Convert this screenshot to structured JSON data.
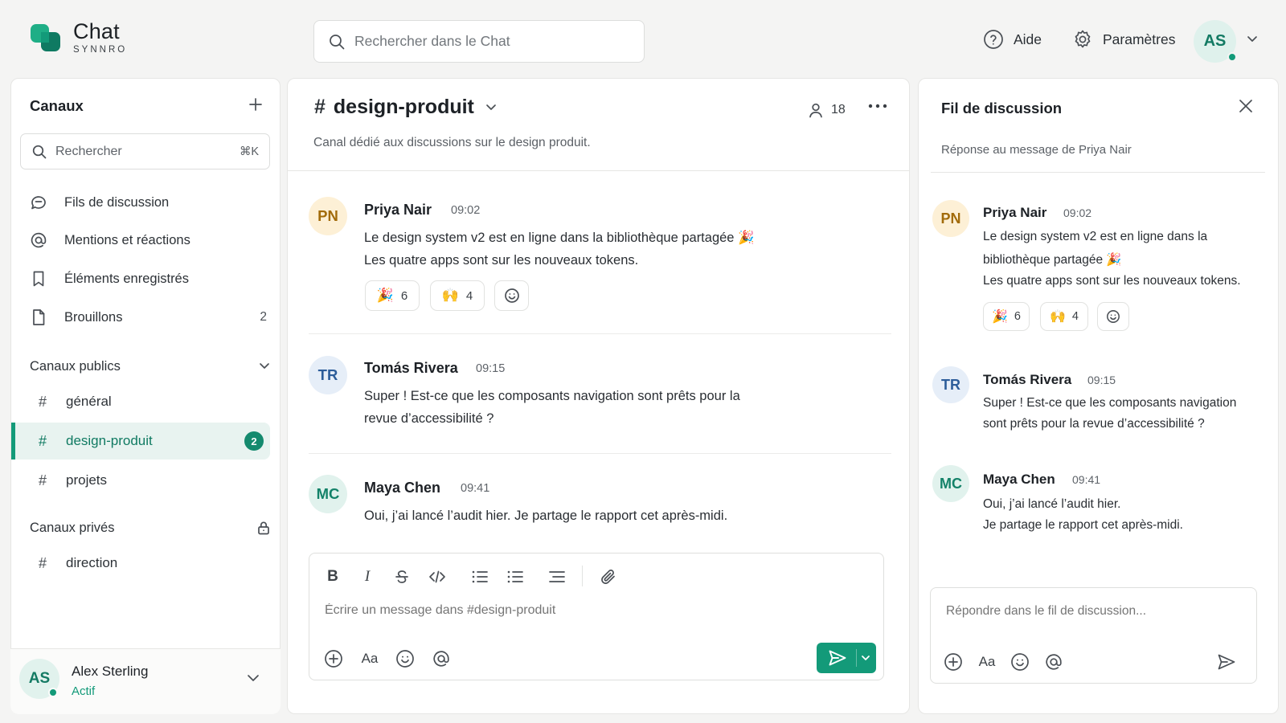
{
  "app": {
    "name": "Chat",
    "brand": "SYNNRO"
  },
  "header": {
    "search_placeholder": "Rechercher dans le Chat",
    "help_label": "Aide",
    "settings_label": "Paramètres",
    "user_initials": "AS"
  },
  "sidebar": {
    "title": "Canaux",
    "search_placeholder": "Rechercher",
    "search_shortcut": "⌘K",
    "items": [
      {
        "label": "Fils de discussion",
        "icon": "threads-icon",
        "count": ""
      },
      {
        "label": "Mentions et réactions",
        "icon": "at-icon",
        "count": ""
      },
      {
        "label": "Éléments enregistrés",
        "icon": "bookmark-icon",
        "count": ""
      },
      {
        "label": "Brouillons",
        "icon": "draft-icon",
        "count": "2"
      }
    ],
    "public_section": "Canaux publics",
    "public_channels": [
      {
        "name": "général",
        "active": false,
        "badge": ""
      },
      {
        "name": "design-produit",
        "active": true,
        "badge": "2"
      },
      {
        "name": "projets",
        "active": false,
        "badge": ""
      }
    ],
    "private_section": "Canaux privés",
    "private_channels": [
      {
        "name": "direction"
      }
    ],
    "user": {
      "initials": "AS",
      "name": "Alex Sterling",
      "status": "Actif"
    }
  },
  "channel": {
    "hash": "#",
    "name": "design-produit",
    "members": "18",
    "description": "Canal dédié aux discussions sur le design produit."
  },
  "messages": [
    {
      "initials": "PN",
      "author": "Priya Nair",
      "time": "09:02",
      "lines": [
        "Le design system v2 est en ligne dans la bibliothèque partagée 🎉",
        "Les quatre apps sont sur les nouveaux tokens."
      ],
      "reactions": [
        {
          "emoji": "🎉",
          "count": "6"
        },
        {
          "emoji": "🙌",
          "count": "4"
        }
      ]
    },
    {
      "initials": "TR",
      "author": "Tomás Rivera",
      "time": "09:15",
      "lines": [
        "Super ! Est-ce que les composants navigation sont prêts pour la",
        "revue d’accessibilité ?"
      ]
    },
    {
      "initials": "MC",
      "author": "Maya Chen",
      "time": "09:41",
      "lines": [
        "Oui, j’ai lancé l’audit hier. Je partage le rapport cet après-midi."
      ]
    }
  ],
  "composer": {
    "placeholder": "Écrire un message dans #design-produit",
    "font_label": "Aa"
  },
  "thread": {
    "title": "Fil de discussion",
    "subtitle": "Réponse au message de Priya Nair",
    "messages": [
      {
        "initials": "PN",
        "author": "Priya Nair",
        "time": "09:02",
        "lines": [
          "Le design system v2 est en ligne dans la",
          "bibliothèque partagée 🎉",
          "Les quatre apps sont sur les nouveaux tokens."
        ],
        "reactions": [
          {
            "emoji": "🎉",
            "count": "6"
          },
          {
            "emoji": "🙌",
            "count": "4"
          }
        ]
      },
      {
        "initials": "TR",
        "author": "Tomás Rivera",
        "time": "09:15",
        "lines": [
          "Super ! Est-ce que les composants navigation",
          "sont prêts pour la revue d’accessibilité ?"
        ]
      },
      {
        "initials": "MC",
        "author": "Maya Chen",
        "time": "09:41",
        "lines": [
          "Oui, j’ai lancé l’audit hier.",
          "Je partage le rapport cet après-midi."
        ]
      }
    ],
    "reply_placeholder": "Répondre dans le fil de discussion...",
    "font_label": "Aa"
  },
  "colors": {
    "accent": "#139a79",
    "accent_soft": "#e8f3f0",
    "background": "#f4f4f3"
  }
}
